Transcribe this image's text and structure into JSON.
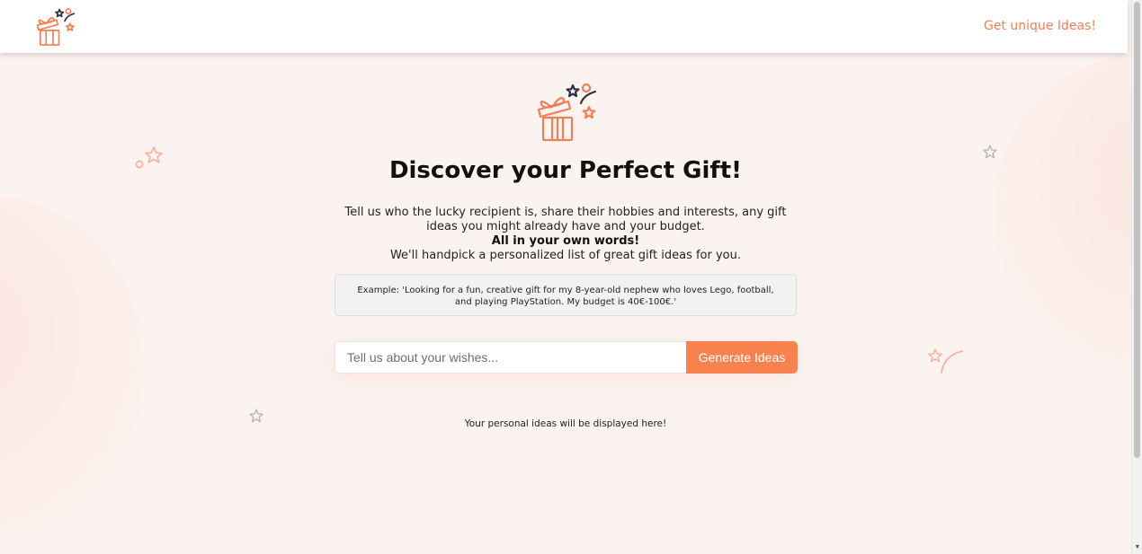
{
  "nav": {
    "logo_icon": "gift-box-icon",
    "link_label": "Get unique Ideas!"
  },
  "hero": {
    "icon": "gift-box-icon",
    "title": "Discover your Perfect Gift!",
    "intro_line1": "Tell us who the lucky recipient is, share their hobbies and interests, any gift ideas you might already have and your budget.",
    "intro_bold": "All in your own words!",
    "intro_line3": "We'll handpick a personalized list of great gift ideas for you."
  },
  "example": {
    "text": "Example: 'Looking for a fun, creative gift for my 8-year-old nephew who loves Lego, football, and playing PlayStation. My budget is 40€-100€.'"
  },
  "form": {
    "input_placeholder": "Tell us about your wishes...",
    "input_value": "",
    "button_label": "Generate Ideas"
  },
  "results": {
    "placeholder_text": "Your personal ideas will be displayed here!"
  },
  "colors": {
    "accent": "#f8824f",
    "link": "#f07f55",
    "background": "#fbf3f0",
    "icon_dark": "#2b3040"
  },
  "decorations": [
    "star-icon",
    "star-icon",
    "star-icon",
    "star-icon",
    "circle-icon",
    "swoosh-icon"
  ]
}
